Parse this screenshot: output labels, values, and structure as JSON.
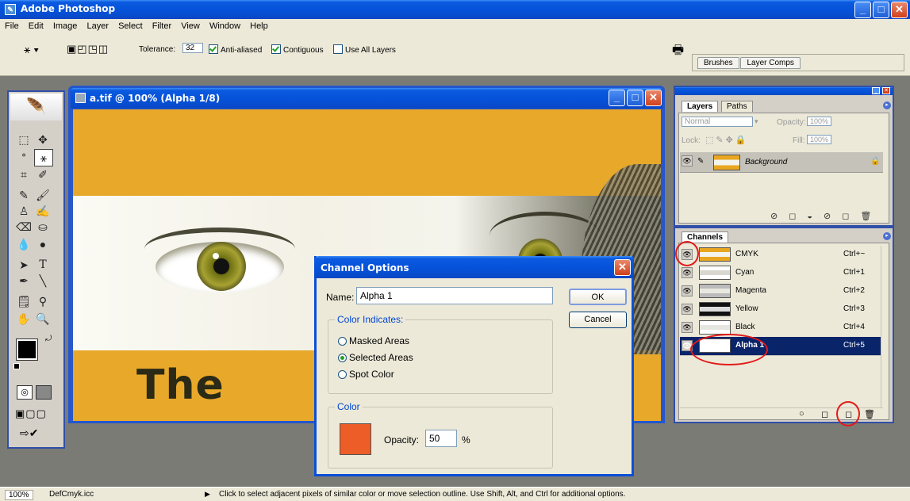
{
  "app": {
    "title": "Adobe Photoshop"
  },
  "menu": [
    "File",
    "Edit",
    "Image",
    "Layer",
    "Select",
    "Filter",
    "View",
    "Window",
    "Help"
  ],
  "options": {
    "tolerance_label": "Tolerance:",
    "tolerance_value": "32",
    "anti_aliased": "Anti-aliased",
    "contiguous": "Contiguous",
    "use_all_layers": "Use All Layers",
    "tabs": [
      "Brushes",
      "Layer Comps"
    ]
  },
  "document": {
    "title": "a.tif @ 100% (Alpha 1/8)",
    "text": "The"
  },
  "layers_palette": {
    "tabs": [
      "Layers",
      "Paths"
    ],
    "blend_mode": "Normal",
    "opacity_label": "Opacity:",
    "opacity_value": "100%",
    "lock_label": "Lock:",
    "fill_label": "Fill:",
    "fill_value": "100%",
    "layer_name": "Background"
  },
  "channels_palette": {
    "tab": "Channels",
    "rows": [
      {
        "name": "CMYK",
        "shortcut": "Ctrl+~"
      },
      {
        "name": "Cyan",
        "shortcut": "Ctrl+1"
      },
      {
        "name": "Magenta",
        "shortcut": "Ctrl+2"
      },
      {
        "name": "Yellow",
        "shortcut": "Ctrl+3"
      },
      {
        "name": "Black",
        "shortcut": "Ctrl+4"
      },
      {
        "name": "Alpha 1",
        "shortcut": "Ctrl+5"
      }
    ]
  },
  "dialog": {
    "title": "Channel Options",
    "name_label": "Name:",
    "name_value": "Alpha 1",
    "ok": "OK",
    "cancel": "Cancel",
    "color_indicates": "Color Indicates:",
    "options": [
      "Masked Areas",
      "Selected Areas",
      "Spot Color"
    ],
    "selected_option": "Selected Areas",
    "color_group": "Color",
    "opacity_label": "Opacity:",
    "opacity_value": "50",
    "opacity_unit": "%",
    "swatch_color": "#ec5d28"
  },
  "status": {
    "zoom": "100%",
    "profile": "DefCmyk.icc",
    "message": "Click to select adjacent pixels of similar color or move selection outline. Use Shift, Alt, and Ctrl for additional options."
  },
  "colors": {
    "doc_orange": "#e8a82a",
    "selection_blue": "#0a246a",
    "highlight_red": "#e21b1b"
  }
}
